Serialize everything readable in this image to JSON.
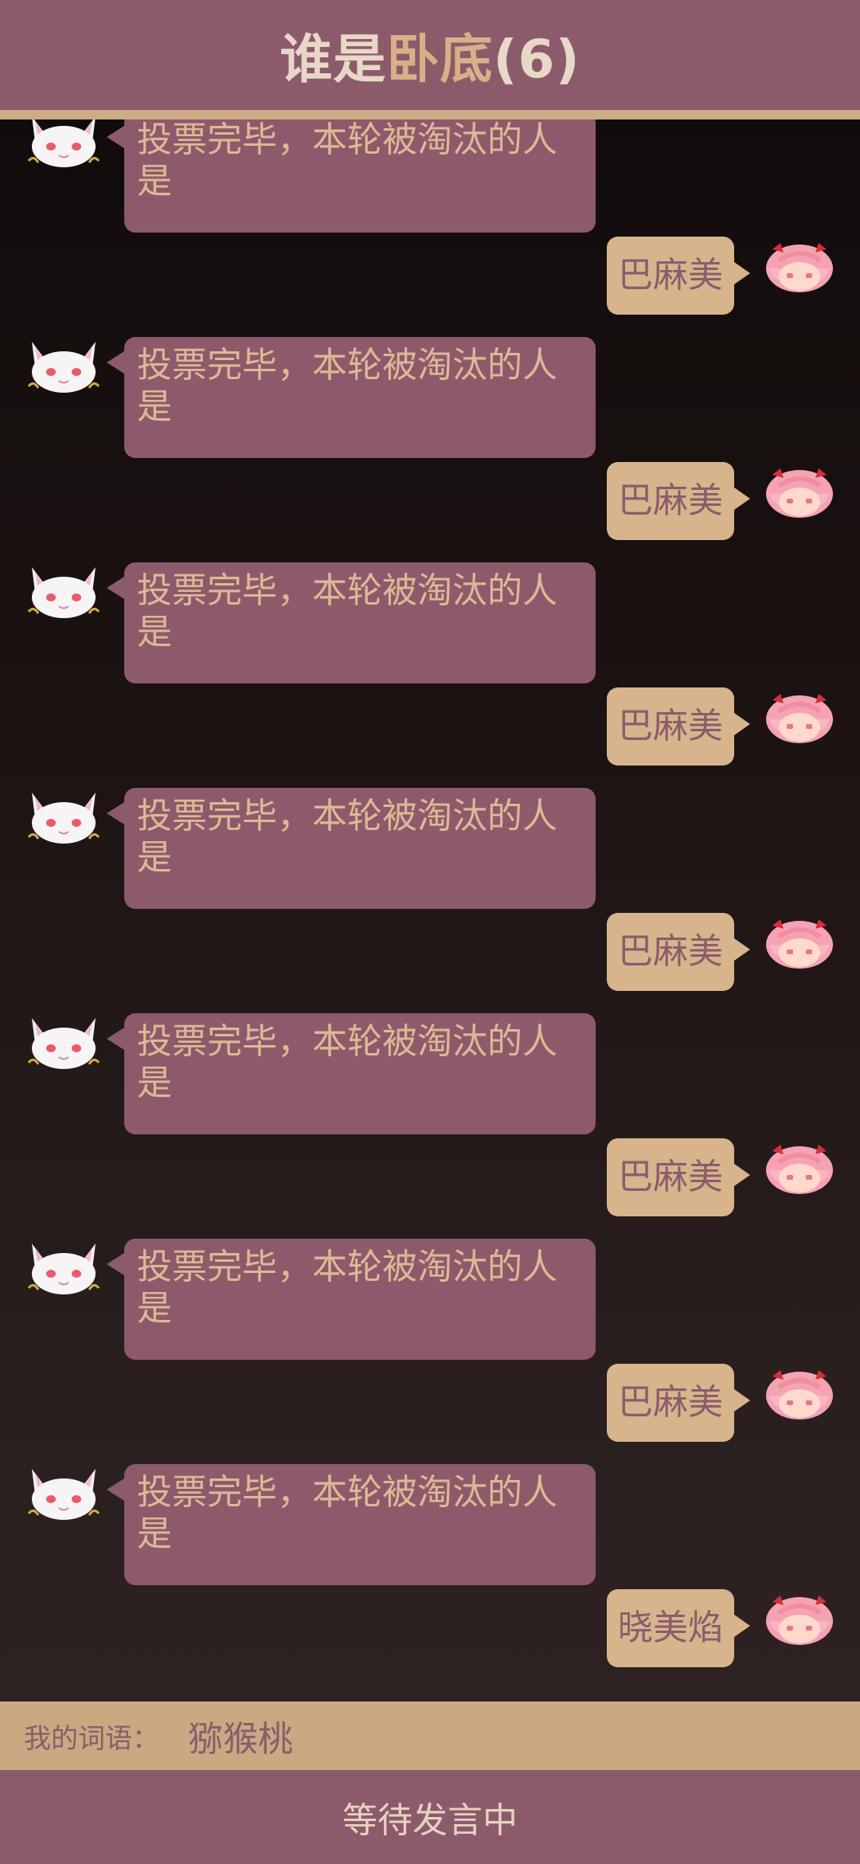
{
  "header": {
    "title_part1": "谁是",
    "title_part2": "卧底",
    "title_part3": "(6)"
  },
  "messages": [
    {
      "side": "left",
      "text": "投票完毕，本轮被淘汰的人是",
      "avatar": "cat-mascot-icon"
    },
    {
      "side": "right",
      "text": "巴麻美",
      "avatar": "pink-hair-girl-icon"
    },
    {
      "side": "left",
      "text": "投票完毕，本轮被淘汰的人是",
      "avatar": "cat-mascot-icon"
    },
    {
      "side": "right",
      "text": "巴麻美",
      "avatar": "pink-hair-girl-icon"
    },
    {
      "side": "left",
      "text": "投票完毕，本轮被淘汰的人是",
      "avatar": "cat-mascot-icon"
    },
    {
      "side": "right",
      "text": "巴麻美",
      "avatar": "pink-hair-girl-icon"
    },
    {
      "side": "left",
      "text": "投票完毕，本轮被淘汰的人是",
      "avatar": "cat-mascot-icon"
    },
    {
      "side": "right",
      "text": "巴麻美",
      "avatar": "pink-hair-girl-icon"
    },
    {
      "side": "left",
      "text": "投票完毕，本轮被淘汰的人是",
      "avatar": "cat-mascot-icon"
    },
    {
      "side": "right",
      "text": "巴麻美",
      "avatar": "pink-hair-girl-icon"
    },
    {
      "side": "left",
      "text": "投票完毕，本轮被淘汰的人是",
      "avatar": "cat-mascot-icon"
    },
    {
      "side": "right",
      "text": "巴麻美",
      "avatar": "pink-hair-girl-icon"
    },
    {
      "side": "left",
      "text": "投票完毕，本轮被淘汰的人是",
      "avatar": "cat-mascot-icon"
    },
    {
      "side": "right",
      "text": "晓美焰",
      "avatar": "pink-hair-girl-icon"
    }
  ],
  "word_bar": {
    "label": "我的词语：",
    "value": "猕猴桃"
  },
  "status_bar": {
    "text": "等待发言中"
  },
  "colors": {
    "header_bg": "#8c5b6b",
    "accent_gold": "#cbac85",
    "left_bubble": "#8d5a6b",
    "right_bubble": "#d7b48c"
  }
}
